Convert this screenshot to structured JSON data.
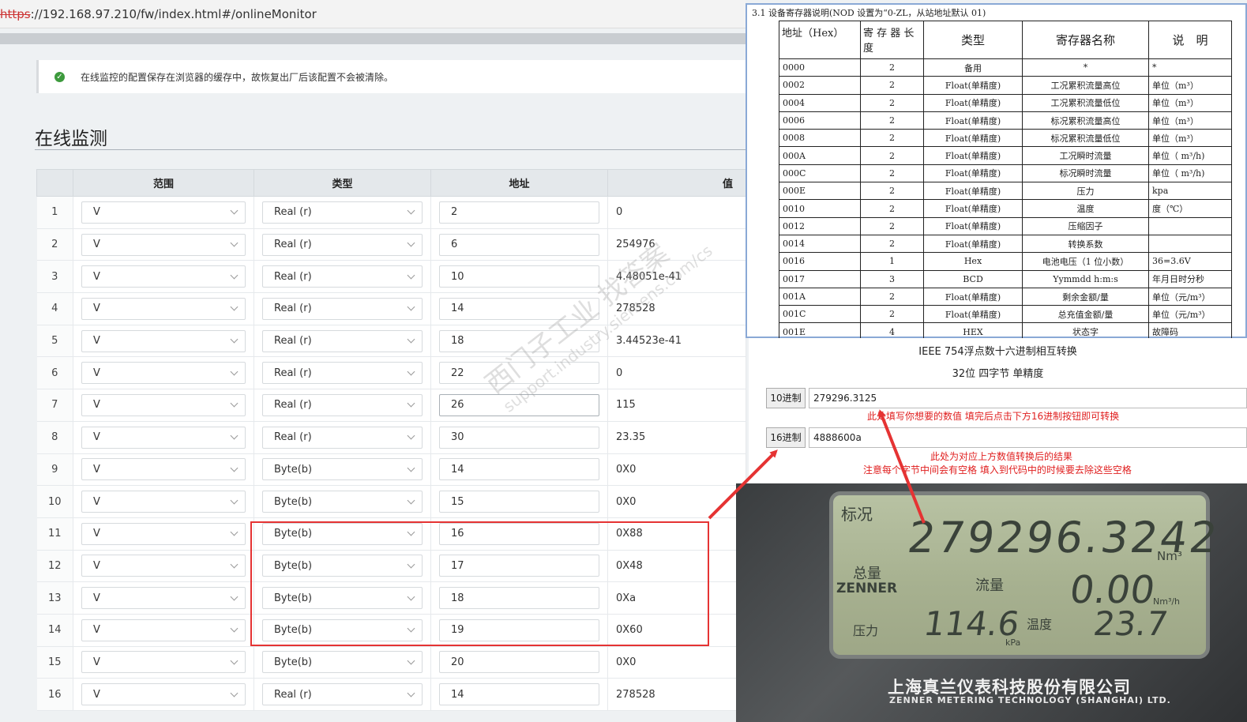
{
  "url": {
    "protocol": "https",
    "rest": "://192.168.97.210/fw/index.html#/onlineMonitor"
  },
  "notice": "在线监控的配置保存在浏览器的缓存中，故恢复出厂后该配置不会被清除。",
  "page_title": "在线监测",
  "table": {
    "headers": [
      "范围",
      "类型",
      "地址",
      "值"
    ],
    "rows": [
      {
        "n": "1",
        "range": "V",
        "type": "Real (r)",
        "addr": "2",
        "value": "0"
      },
      {
        "n": "2",
        "range": "V",
        "type": "Real (r)",
        "addr": "6",
        "value": "254976"
      },
      {
        "n": "3",
        "range": "V",
        "type": "Real (r)",
        "addr": "10",
        "value": "4.48051e-41"
      },
      {
        "n": "4",
        "range": "V",
        "type": "Real (r)",
        "addr": "14",
        "value": "278528"
      },
      {
        "n": "5",
        "range": "V",
        "type": "Real (r)",
        "addr": "18",
        "value": "3.44523e-41"
      },
      {
        "n": "6",
        "range": "V",
        "type": "Real (r)",
        "addr": "22",
        "value": "0"
      },
      {
        "n": "7",
        "range": "V",
        "type": "Real (r)",
        "addr": "26",
        "value": "115"
      },
      {
        "n": "8",
        "range": "V",
        "type": "Real (r)",
        "addr": "30",
        "value": "23.35"
      },
      {
        "n": "9",
        "range": "V",
        "type": "Byte(b)",
        "addr": "14",
        "value": "0X0"
      },
      {
        "n": "10",
        "range": "V",
        "type": "Byte(b)",
        "addr": "15",
        "value": "0X0"
      },
      {
        "n": "11",
        "range": "V",
        "type": "Byte(b)",
        "addr": "16",
        "value": "0X88"
      },
      {
        "n": "12",
        "range": "V",
        "type": "Byte(b)",
        "addr": "17",
        "value": "0X48"
      },
      {
        "n": "13",
        "range": "V",
        "type": "Byte(b)",
        "addr": "18",
        "value": "0Xa"
      },
      {
        "n": "14",
        "range": "V",
        "type": "Byte(b)",
        "addr": "19",
        "value": "0X60"
      },
      {
        "n": "15",
        "range": "V",
        "type": "Byte(b)",
        "addr": "20",
        "value": "0X0"
      },
      {
        "n": "16",
        "range": "V",
        "type": "Real (r)",
        "addr": "14",
        "value": "278528"
      }
    ]
  },
  "watermark": {
    "line1": "西门子工业 找答案",
    "line2": "support.industry.siemens.com/cs"
  },
  "register_doc": {
    "caption": "3.1 设备寄存器说明(NOD 设置为“0-ZL，从站地址默认 01)",
    "headers": [
      "地址（Hex）",
      "寄 存 器 长 度",
      "类型",
      "寄存器名称",
      "说　明"
    ],
    "rows": [
      [
        "0000",
        "2",
        "备用",
        "*",
        "*"
      ],
      [
        "0002",
        "2",
        "Float(单精度)",
        "工况累积流量高位",
        "单位（m³）"
      ],
      [
        "0004",
        "2",
        "Float(单精度)",
        "工况累积流量低位",
        "单位（m³）"
      ],
      [
        "0006",
        "2",
        "Float(单精度)",
        "标况累积流量高位",
        "单位（m³）"
      ],
      [
        "0008",
        "2",
        "Float(单精度)",
        "标况累积流量低位",
        "单位（m³）"
      ],
      [
        "000A",
        "2",
        "Float(单精度)",
        "工况瞬时流量",
        "单位（ m³/h)"
      ],
      [
        "000C",
        "2",
        "Float(单精度)",
        "标况瞬时流量",
        "单位（ m³/h)"
      ],
      [
        "000E",
        "2",
        "Float(单精度)",
        "压力",
        "kpa"
      ],
      [
        "0010",
        "2",
        "Float(单精度)",
        "温度",
        "度（℃）"
      ],
      [
        "0012",
        "2",
        "Float(单精度)",
        "压缩因子",
        ""
      ],
      [
        "0014",
        "2",
        "Float(单精度)",
        "转换系数",
        ""
      ],
      [
        "0016",
        "1",
        "Hex",
        "电池电压（1 位小数）",
        "36=3.6V"
      ],
      [
        "0017",
        "3",
        "BCD",
        "Yymmdd h:m:s",
        "年月日时分秒"
      ],
      [
        "001A",
        "2",
        "Float(单精度)",
        "剩余金额/量",
        "单位（元/m³）"
      ],
      [
        "001C",
        "2",
        "Float(单精度)",
        "总充值金额/量",
        "单位（元/m³）"
      ],
      [
        "001E",
        "4",
        "HEX",
        "状态字",
        "故障码"
      ]
    ]
  },
  "converter": {
    "title": "IEEE 754浮点数十六进制相互转换",
    "subtitle": "32位 四字节 单精度",
    "dec_label": "10进制",
    "dec_value": "279296.3125",
    "hex_label": "16进制",
    "hex_value": "4888600a",
    "note1": "此处填写你想要的数值 填完后点击下方16进制按钮即可转换",
    "note2": "此处为对应上方数值转换后的结果",
    "note3": "注意每个字节中间会有空格 填入到代码中的时候要去除这些空格"
  },
  "meter": {
    "label_std": "标况",
    "total_value": "279296.3242",
    "unit_nm3": "Nm³",
    "label_total": "总量",
    "brand_lcd": "ZENNER",
    "label_flow": "流量",
    "flow_value": "0.00",
    "unit_flow": "Nm³/h",
    "label_pressure": "压力",
    "pressure_value": "114.6",
    "unit_kpa": "kPa",
    "label_temp": "温度",
    "temp_value": "23.7",
    "brand_cn": "上海真兰仪表科技股份有限公司",
    "brand_en": "ZENNER METERING TECHNOLOGY (SHANGHAI) LTD."
  },
  "colors": {
    "highlight": "#e53333",
    "ok_icon": "#3d9a3d"
  }
}
